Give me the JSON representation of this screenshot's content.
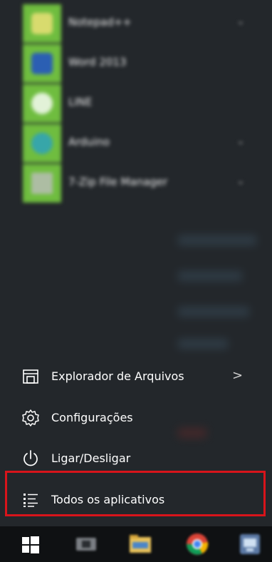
{
  "app_list": {
    "items": [
      {
        "name": "Notepad++",
        "has_submenu": true,
        "icon": "notepad-plus-icon",
        "glyph_color": "#f2e27a"
      },
      {
        "name": "Word 2013",
        "has_submenu": false,
        "icon": "word-icon",
        "glyph_color": "#2b5fb3"
      },
      {
        "name": "LINE",
        "has_submenu": false,
        "icon": "line-icon",
        "glyph_color": "#ffffff"
      },
      {
        "name": "Arduino",
        "has_submenu": true,
        "icon": "arduino-icon",
        "glyph_color": "#37a6a9"
      },
      {
        "name": "7-Zip File Manager",
        "has_submenu": true,
        "icon": "seven-zip-icon",
        "glyph_color": "#bdbdbd"
      }
    ],
    "tile_color": "#6fbd3f"
  },
  "menu": {
    "file_explorer_label": "Explorador de Arquivos",
    "file_explorer_chevron": ">",
    "settings_label": "Configurações",
    "power_label": "Ligar/Desligar",
    "all_apps_label": "Todos os aplicativos"
  },
  "highlight_color": "#d8141b",
  "taskbar": {
    "items": [
      "start-button",
      "task-view-icon",
      "file-explorer-icon",
      "chrome-icon",
      "pinned-app-icon"
    ]
  }
}
